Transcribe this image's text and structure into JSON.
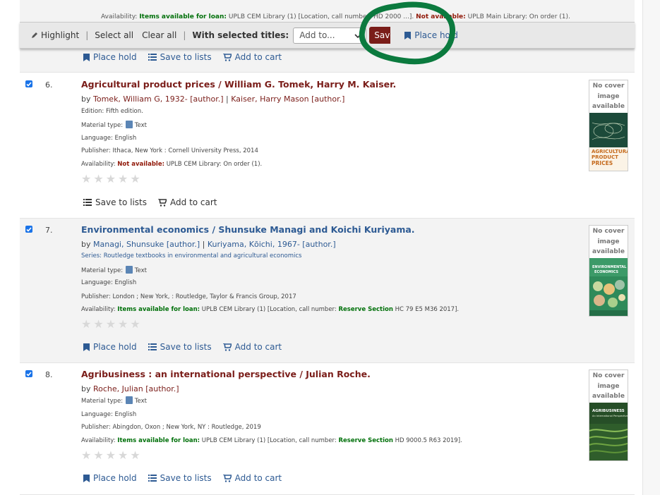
{
  "colors": {
    "link_blue": "#2d5a93",
    "title_brown": "#7a1d19",
    "available_green": "#00700a",
    "unavailable_red": "#901808",
    "annotation_green": "#0b7a3e"
  },
  "prev_row": {
    "availability_prefix": "Availability:",
    "availability_status": "Items available for loan:",
    "availability_detail": "UPLB CEM Library (1) [Location, call number: HD 2000 ...].",
    "availability_status2": "Not available:",
    "availability_detail2": "UPLB Main Library: On order (1)."
  },
  "toolbar": {
    "highlight": "Highlight",
    "select_all": "Select all",
    "clear_all": "Clear all",
    "with_selected": "With selected titles:",
    "add_to_value": "Add to...",
    "save_label": "Save",
    "place_hold": "Place hold"
  },
  "prev_actions": {
    "place_hold": "Place hold",
    "save_to_lists": "Save to lists",
    "add_to_cart": "Add to cart"
  },
  "results": [
    {
      "number": "6.",
      "title": "Agricultural product prices / William G. Tomek, Harry M. Kaiser.",
      "by": "by",
      "author1": "Tomek, William G, 1932- [author.]",
      "author2": "Kaiser, Harry Mason [author.]",
      "edition": "Edition: Fifth edition.",
      "material_label": "Material type:",
      "material_value": "Text",
      "language": "Language: English",
      "publisher": "Publisher: Ithaca, New York : Cornell University Press, 2014",
      "availability_label": "Availability:",
      "availability_status": "Not available:",
      "availability_detail": "UPLB CEM Library: On order (1).",
      "no_cover": "No cover image available",
      "cover_title": "AGRICULTURAL PRODUCT PRICES",
      "save_to_lists": "Save to lists",
      "add_to_cart": "Add to cart",
      "rating": 0
    },
    {
      "number": "7.",
      "title": "Environmental economics / Shunsuke Managi and Koichi Kuriyama.",
      "by": "by",
      "author1": "Managi, Shunsuke [author.]",
      "author2": "Kuriyama, Kōichi, 1967- [author.]",
      "series": "Series: Routledge textbooks in environmental and agricultural economics",
      "material_label": "Material type:",
      "material_value": "Text",
      "language": "Language: English",
      "publisher": "Publisher: London ; New York, : Routledge, Taylor & Francis Group, 2017",
      "availability_label": "Availability:",
      "availability_status": "Items available for loan:",
      "availability_mid": "UPLB CEM Library (1) [Location, call number:",
      "availability_loc": "Reserve Section",
      "availability_call": "HC 79 E5 M36 2017].",
      "no_cover": "No cover image available",
      "cover_title": "ENVIRONMENTAL ECONOMICS",
      "place_hold": "Place hold",
      "save_to_lists": "Save to lists",
      "add_to_cart": "Add to cart",
      "rating": 0
    },
    {
      "number": "8.",
      "title": "Agribusiness : an international perspective / Julian Roche.",
      "by": "by",
      "author1": "Roche, Julian [author.]",
      "material_label": "Material type:",
      "material_value": "Text",
      "language": "Language: English",
      "publisher": "Publisher: Abingdon, Oxon ; New York, NY : Routledge, 2019",
      "availability_label": "Availability:",
      "availability_status": "Items available for loan:",
      "availability_mid": "UPLB CEM Library (1) [Location, call number:",
      "availability_loc": "Reserve Section",
      "availability_call": "HD 9000.5 R63 2019].",
      "no_cover": "No cover image available",
      "cover_title": "AGRIBUSINESS",
      "cover_subtitle": "An International Perspective",
      "place_hold": "Place hold",
      "save_to_lists": "Save to lists",
      "add_to_cart": "Add to cart",
      "rating": 0
    }
  ]
}
